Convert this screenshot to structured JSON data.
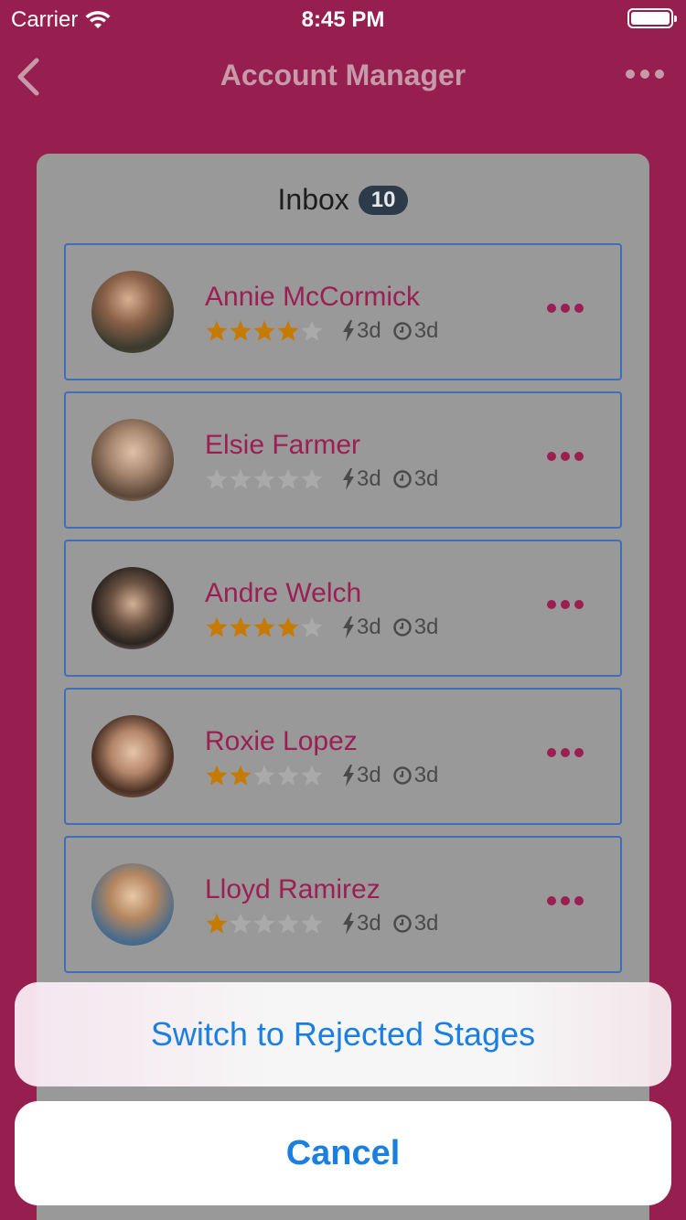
{
  "status_bar": {
    "carrier": "Carrier",
    "time": "8:45 PM"
  },
  "nav": {
    "title": "Account Manager"
  },
  "inbox": {
    "title": "Inbox",
    "count": "10"
  },
  "contacts": [
    {
      "name": "Annie McCormick",
      "rating": 4,
      "response": "3d",
      "age": "3d"
    },
    {
      "name": "Elsie Farmer",
      "rating": 0,
      "response": "3d",
      "age": "3d"
    },
    {
      "name": "Andre Welch",
      "rating": 4,
      "response": "3d",
      "age": "3d"
    },
    {
      "name": "Roxie Lopez",
      "rating": 2,
      "response": "3d",
      "age": "3d"
    },
    {
      "name": "Lloyd Ramirez",
      "rating": 1,
      "response": "3d",
      "age": "3d"
    }
  ],
  "action_sheet": {
    "option": "Switch to Rejected Stages",
    "cancel": "Cancel"
  },
  "colors": {
    "background": "#961f4f",
    "accent": "#9c1f54",
    "star_filled": "#c77a00",
    "star_empty": "#aaaaaa",
    "action_blue": "#1a7fe0"
  }
}
